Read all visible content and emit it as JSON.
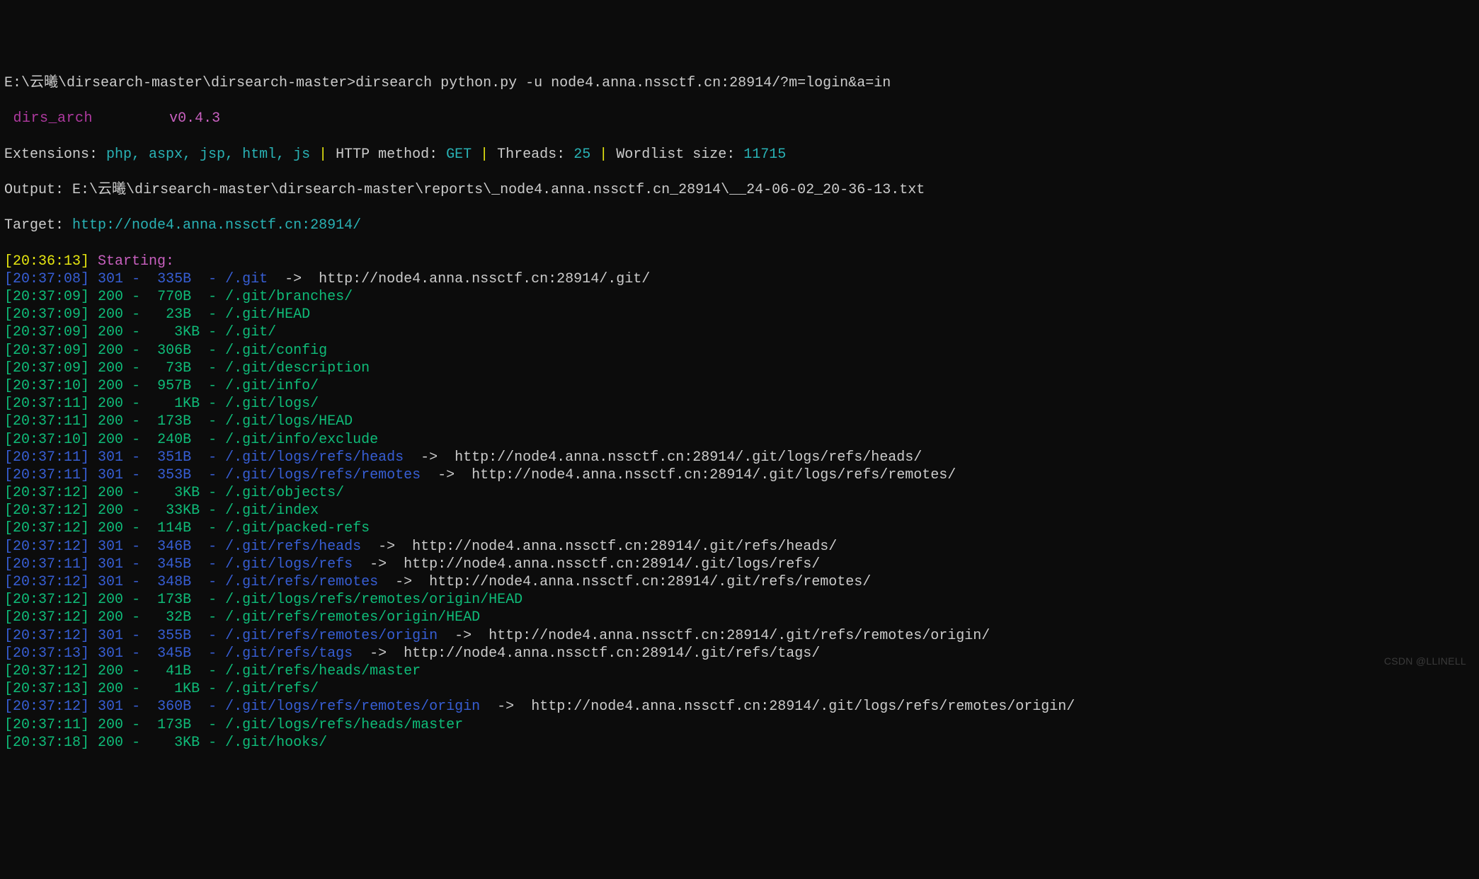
{
  "prompt": "E:\\云曦\\dirsearch-master\\dirsearch-master>dirsearch python.py -u node4.anna.nssctf.cn:28914/?m=login&a=in",
  "logo_text": " dirs_arch",
  "version": "v0.4.3",
  "ext_label": "Extensions: ",
  "ext_vals": "php, aspx, jsp, html, js",
  "sep": " | ",
  "http_method_label": "HTTP method: ",
  "http_method": "GET",
  "threads_label": "Threads: ",
  "threads": "25",
  "wordlist_label": "Wordlist size: ",
  "wordlist": "11715",
  "output_line": "Output: E:\\云曦\\dirsearch-master\\dirsearch-master\\reports\\_node4.anna.nssctf.cn_28914\\__24-06-02_20-36-13.txt",
  "target_label": "Target: ",
  "target_url": "http://node4.anna.nssctf.cn:28914/",
  "start_time": "[20:36:13]",
  "start_label": " Starting: ",
  "rows": [
    {
      "ts": "[20:37:08]",
      "status": "301",
      "dash": " -  ",
      "size": "335B ",
      "path": " - /.git",
      "arrow": "  ->  ",
      "redir": "http://node4.anna.nssctf.cn:28914/.git/"
    },
    {
      "ts": "[20:37:09]",
      "status": "200",
      "dash": " -  ",
      "size": "770B ",
      "path": " - /.git/branches/"
    },
    {
      "ts": "[20:37:09]",
      "status": "200",
      "dash": " -   ",
      "size": "23B ",
      "path": " - /.git/HEAD"
    },
    {
      "ts": "[20:37:09]",
      "status": "200",
      "dash": " -    ",
      "size": "3KB",
      "path": " - /.git/"
    },
    {
      "ts": "[20:37:09]",
      "status": "200",
      "dash": " -  ",
      "size": "306B ",
      "path": " - /.git/config"
    },
    {
      "ts": "[20:37:09]",
      "status": "200",
      "dash": " -   ",
      "size": "73B ",
      "path": " - /.git/description"
    },
    {
      "ts": "[20:37:10]",
      "status": "200",
      "dash": " -  ",
      "size": "957B ",
      "path": " - /.git/info/"
    },
    {
      "ts": "[20:37:11]",
      "status": "200",
      "dash": " -    ",
      "size": "1KB",
      "path": " - /.git/logs/"
    },
    {
      "ts": "[20:37:11]",
      "status": "200",
      "dash": " -  ",
      "size": "173B ",
      "path": " - /.git/logs/HEAD"
    },
    {
      "ts": "[20:37:10]",
      "status": "200",
      "dash": " -  ",
      "size": "240B ",
      "path": " - /.git/info/exclude"
    },
    {
      "ts": "[20:37:11]",
      "status": "301",
      "dash": " -  ",
      "size": "351B ",
      "path": " - /.git/logs/refs/heads",
      "arrow": "  ->  ",
      "redir": "http://node4.anna.nssctf.cn:28914/.git/logs/refs/heads/"
    },
    {
      "ts": "[20:37:11]",
      "status": "301",
      "dash": " -  ",
      "size": "353B ",
      "path": " - /.git/logs/refs/remotes",
      "arrow": "  ->  ",
      "redir": "http://node4.anna.nssctf.cn:28914/.git/logs/refs/remotes/"
    },
    {
      "ts": "[20:37:12]",
      "status": "200",
      "dash": " -    ",
      "size": "3KB",
      "path": " - /.git/objects/"
    },
    {
      "ts": "[20:37:12]",
      "status": "200",
      "dash": " -   ",
      "size": "33KB",
      "path": " - /.git/index"
    },
    {
      "ts": "[20:37:12]",
      "status": "200",
      "dash": " -  ",
      "size": "114B ",
      "path": " - /.git/packed-refs"
    },
    {
      "ts": "[20:37:12]",
      "status": "301",
      "dash": " -  ",
      "size": "346B ",
      "path": " - /.git/refs/heads",
      "arrow": "  ->  ",
      "redir": "http://node4.anna.nssctf.cn:28914/.git/refs/heads/"
    },
    {
      "ts": "[20:37:11]",
      "status": "301",
      "dash": " -  ",
      "size": "345B ",
      "path": " - /.git/logs/refs",
      "arrow": "  ->  ",
      "redir": "http://node4.anna.nssctf.cn:28914/.git/logs/refs/"
    },
    {
      "ts": "[20:37:12]",
      "status": "301",
      "dash": " -  ",
      "size": "348B ",
      "path": " - /.git/refs/remotes",
      "arrow": "  ->  ",
      "redir": "http://node4.anna.nssctf.cn:28914/.git/refs/remotes/"
    },
    {
      "ts": "[20:37:12]",
      "status": "200",
      "dash": " -  ",
      "size": "173B ",
      "path": " - /.git/logs/refs/remotes/origin/HEAD"
    },
    {
      "ts": "[20:37:12]",
      "status": "200",
      "dash": " -   ",
      "size": "32B ",
      "path": " - /.git/refs/remotes/origin/HEAD"
    },
    {
      "ts": "[20:37:12]",
      "status": "301",
      "dash": " -  ",
      "size": "355B ",
      "path": " - /.git/refs/remotes/origin",
      "arrow": "  ->  ",
      "redir": "http://node4.anna.nssctf.cn:28914/.git/refs/remotes/origin/"
    },
    {
      "ts": "[20:37:13]",
      "status": "301",
      "dash": " -  ",
      "size": "345B ",
      "path": " - /.git/refs/tags",
      "arrow": "  ->  ",
      "redir": "http://node4.anna.nssctf.cn:28914/.git/refs/tags/"
    },
    {
      "ts": "[20:37:12]",
      "status": "200",
      "dash": " -   ",
      "size": "41B ",
      "path": " - /.git/refs/heads/master"
    },
    {
      "ts": "[20:37:13]",
      "status": "200",
      "dash": " -    ",
      "size": "1KB",
      "path": " - /.git/refs/"
    },
    {
      "ts": "[20:37:12]",
      "status": "301",
      "dash": " -  ",
      "size": "360B ",
      "path": " - /.git/logs/refs/remotes/origin",
      "arrow": "  ->  ",
      "redir": "http://node4.anna.nssctf.cn:28914/.git/logs/refs/remotes/origin/"
    },
    {
      "ts": "[20:37:11]",
      "status": "200",
      "dash": " -  ",
      "size": "173B ",
      "path": " - /.git/logs/refs/heads/master"
    },
    {
      "ts": "[20:37:18]",
      "status": "200",
      "dash": " -    ",
      "size": "3KB",
      "path": " - /.git/hooks/"
    }
  ],
  "watermark": "CSDN @LLINELL"
}
